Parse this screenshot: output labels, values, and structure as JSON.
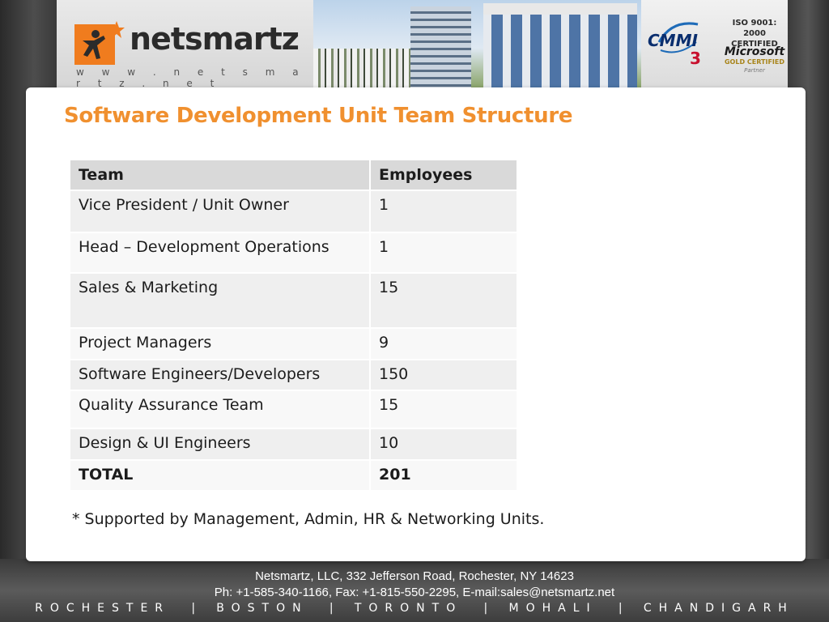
{
  "header": {
    "logo_word": "netsmartz",
    "logo_url": "w w w . n e t s m a r t z . n e t",
    "cmmi_text": "CMMI",
    "cmmi_level": "3",
    "iso_line1": "ISO 9001: 2000",
    "iso_line2": "CERTIFIED",
    "ms_logo": "Microsoft",
    "ms_gold": "GOLD CERTIFIED",
    "ms_partner": "Partner"
  },
  "slide": {
    "title": "Software Development Unit Team Structure",
    "table": {
      "headers": [
        "Team",
        "Employees"
      ],
      "rows": [
        {
          "team": "Vice President / Unit Owner",
          "employees": "1"
        },
        {
          "team": "Head – Development Operations",
          "employees": "1"
        },
        {
          "team": "Sales & Marketing",
          "employees": "15"
        },
        {
          "team": "Project Managers",
          "employees": "9"
        },
        {
          "team": "Software Engineers/Developers",
          "employees": "150"
        },
        {
          "team": "Quality Assurance Team",
          "employees": "15"
        },
        {
          "team": "Design & UI Engineers",
          "employees": "10"
        },
        {
          "team": "TOTAL",
          "employees": "201"
        }
      ]
    },
    "footnote": "* Supported by Management, Admin, HR & Networking Units."
  },
  "footer": {
    "address": "Netsmartz, LLC, 332 Jefferson Road, Rochester, NY  14623",
    "contact": "Ph: +1-585-340-1166, Fax: +1-815-550-2295, E-mail:sales@netsmartz.net",
    "cities": [
      "ROCHESTER",
      "BOSTON",
      "TORONTO",
      "MOHALI",
      "CHANDIGARH"
    ],
    "separator": "|"
  },
  "colors": {
    "title": "#f0902f",
    "logo_orange": "#f07c1e",
    "header_row": "#d9d9d9",
    "row_dark": "#efefef",
    "row_light": "#f8f8f8"
  }
}
